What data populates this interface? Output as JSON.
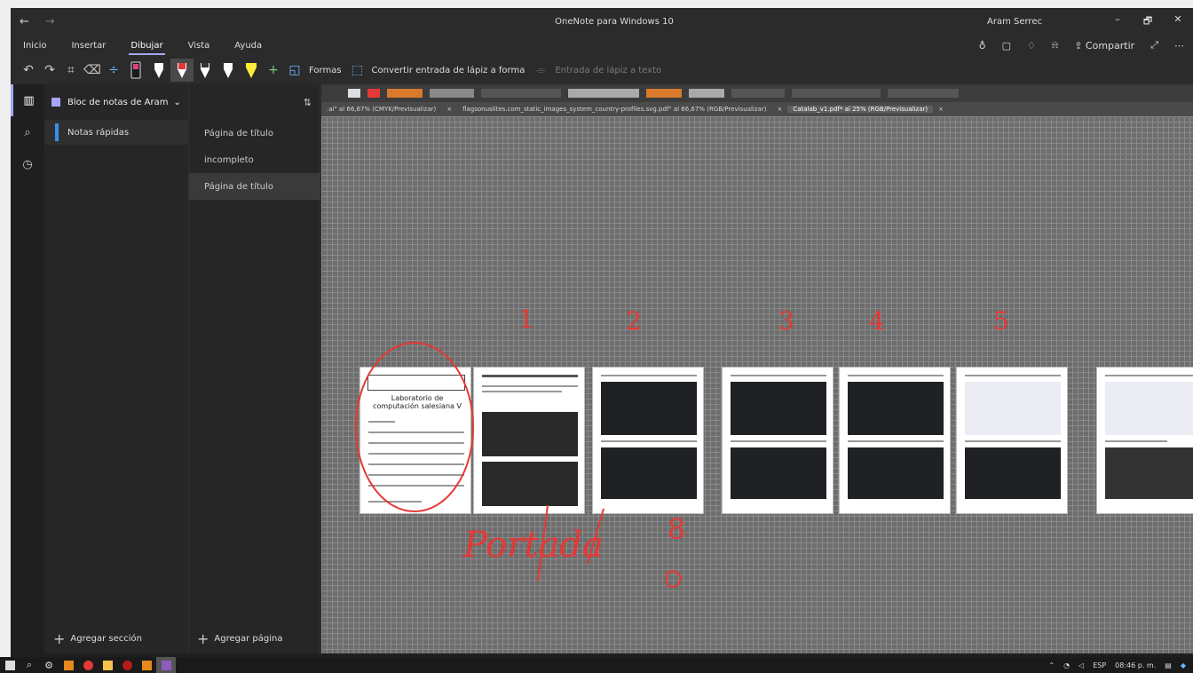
{
  "window": {
    "title": "OneNote para Windows 10",
    "user": "Aram Serrec",
    "back": "←",
    "forward": "→",
    "minimize": "–",
    "maximize": "🗗",
    "close": "✕"
  },
  "ribbon_tabs": [
    "Inicio",
    "Insertar",
    "Dibujar",
    "Vista",
    "Ayuda"
  ],
  "active_tab": "Dibujar",
  "ribbon": {
    "shapes_label": "Formas",
    "ink_to_shape_label": "Convertir entrada de lápiz a forma",
    "ink_to_text_label": "Entrada de lápiz a texto",
    "share_label": "Compartir",
    "pen_colors": [
      "#d9d9d9",
      "#ffffff",
      "#e53935",
      "#ffffff",
      "#ffffff",
      "#ffeb3b"
    ]
  },
  "notebook": {
    "name": "Bloc de notas de Aram",
    "sections": [
      {
        "name": "Notas rápidas",
        "color": "#3b8eea"
      }
    ],
    "pages": [
      "Página de título",
      "incompleto",
      "Página de título"
    ],
    "selected_page": 2,
    "add_section": "Agregar sección",
    "add_page": "Agregar página"
  },
  "embedded_app": {
    "tabs": [
      ".ai\" al 66,67% (CMYK/Previsualizar)",
      "flagsonuslites.com_static_images_system_country-profiles.svg.pdf\" al 66,67% (RGB/Previsualizar)",
      "Catalab_v1.pdf* al 25% (RGB/Previsualizar)"
    ],
    "active_tab": 2
  },
  "annotations": {
    "numbers": [
      "1",
      "2",
      "3",
      "4",
      "5"
    ],
    "handwriting": "Portada",
    "extra_mark": "8"
  },
  "thumbnails": [
    {
      "kind": "cover",
      "title": "Laboratorio de computación salesiana V"
    },
    {
      "kind": "catalog"
    },
    {
      "kind": "dark"
    },
    {
      "kind": "dark"
    },
    {
      "kind": "dark"
    },
    {
      "kind": "mixed"
    },
    {
      "kind": "mixed"
    }
  ],
  "taskbar": {
    "tray_lang": "ESP",
    "tray_time": "08:46 p. m."
  }
}
